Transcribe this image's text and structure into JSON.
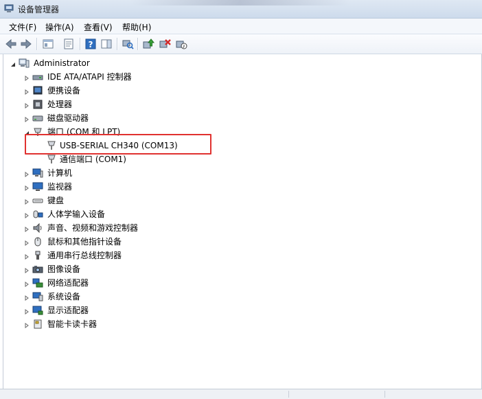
{
  "window": {
    "title": "设备管理器"
  },
  "menu": [
    {
      "label": "文件(F)"
    },
    {
      "label": "操作(A)"
    },
    {
      "label": "查看(V)"
    },
    {
      "label": "帮助(H)"
    }
  ],
  "tree": {
    "root": {
      "label": "Administrator",
      "expanded": true
    },
    "categories": [
      {
        "label": "IDE ATA/ATAPI 控制器",
        "icon": "ide-controller-icon"
      },
      {
        "label": "便携设备",
        "icon": "portable-device-icon"
      },
      {
        "label": "处理器",
        "icon": "processor-icon"
      },
      {
        "label": "磁盘驱动器",
        "icon": "disk-drive-icon"
      },
      {
        "label": "端口 (COM 和 LPT)",
        "icon": "port-icon",
        "expanded": true,
        "children": [
          {
            "label": "USB-SERIAL CH340 (COM13)",
            "icon": "port-connector-icon",
            "highlighted": true
          },
          {
            "label": "通信端口 (COM1)",
            "icon": "port-connector-icon"
          }
        ]
      },
      {
        "label": "计算机",
        "icon": "computer-icon"
      },
      {
        "label": "监视器",
        "icon": "monitor-icon"
      },
      {
        "label": "键盘",
        "icon": "keyboard-icon"
      },
      {
        "label": "人体学输入设备",
        "icon": "hid-icon"
      },
      {
        "label": "声音、视频和游戏控制器",
        "icon": "sound-icon"
      },
      {
        "label": "鼠标和其他指针设备",
        "icon": "mouse-icon"
      },
      {
        "label": "通用串行总线控制器",
        "icon": "usb-icon"
      },
      {
        "label": "图像设备",
        "icon": "camera-icon"
      },
      {
        "label": "网络适配器",
        "icon": "network-adapter-icon"
      },
      {
        "label": "系统设备",
        "icon": "system-device-icon"
      },
      {
        "label": "显示适配器",
        "icon": "display-adapter-icon"
      },
      {
        "label": "智能卡读卡器",
        "icon": "smart-card-reader-icon"
      }
    ]
  },
  "colors": {
    "highlight_border": "#e0312f",
    "titlebar": "#d6e2f0",
    "accent_blue": "#2f6fc0"
  }
}
